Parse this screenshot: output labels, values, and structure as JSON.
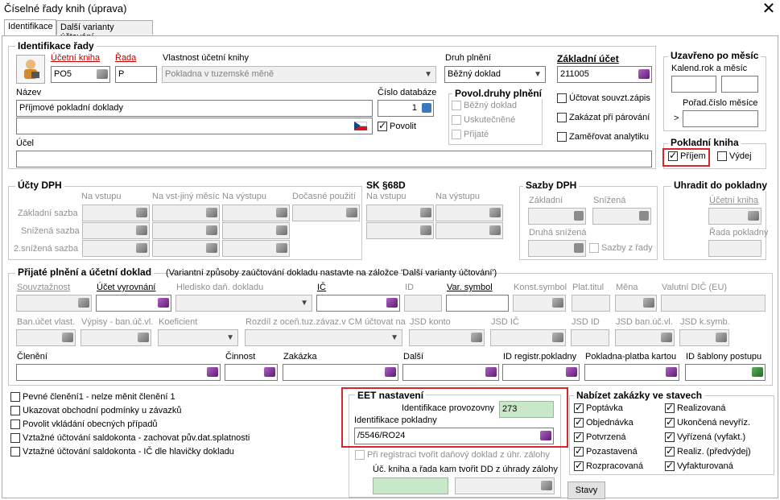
{
  "window": {
    "title": "Číselné řady knih (úprava)",
    "close": "✕"
  },
  "tabs": [
    "Identifikace",
    "Další varianty účtování"
  ],
  "ident": {
    "group_title": "Identifikace řady",
    "ucetni_kniha_label": "Účetní kniha",
    "ucetni_kniha_value": "PO5",
    "rada_label": "Řada",
    "rada_value": "P",
    "vlastnost_label": "Vlastnost účetní knihy",
    "vlastnost_value": "Pokladna v tuzemské měně",
    "nazev_label": "Název",
    "nazev_value": "Příjmové pokladní doklady",
    "cislo_db_label": "Číslo databáze",
    "cislo_db_value": "1",
    "povolit_label": "Povolit",
    "ucel_label": "Účel",
    "druh_plneni_label": "Druh plnění",
    "druh_plneni_value": "Běžný doklad",
    "zakladni_ucet_label": "Základní účet",
    "zakladni_ucet_value": "211005",
    "povol_title": "Povol.druhy plnění",
    "povol_items": [
      "Běžný doklad",
      "Uskutečněné",
      "Přijaté"
    ],
    "opts": [
      "Účtovat souvzt.zápis",
      "Zakázat při párování",
      "Zaměřovat analytiku"
    ]
  },
  "uzavreno": {
    "title": "Uzavřeno po měsíc",
    "kalend": "Kalend.rok a měsíc",
    "porad": "Pořad.číslo měsíce",
    "gt": ">"
  },
  "pokladni": {
    "title": "Pokladní kniha",
    "prijem": "Příjem",
    "vydej": "Výdej"
  },
  "ucty_dph": {
    "title": "Účty DPH",
    "cols": [
      "Na vstupu",
      "Na vst-jiný měsíc",
      "Na výstupu",
      "Dočasné použití"
    ],
    "rows": [
      "Základní sazba",
      "Snížená sazba",
      "2.snížená sazba"
    ]
  },
  "sk68": {
    "title": "SK §68D",
    "cols": [
      "Na vstupu",
      "Na výstupu"
    ]
  },
  "sazby": {
    "title": "Sazby DPH",
    "zakladni": "Základní",
    "snizena": "Snížená",
    "druha": "Druhá snížená",
    "sazby_z_rady": "Sazby z řady"
  },
  "uhradit": {
    "title": "Uhradit do pokladny",
    "ucetni_kniha": "Účetní kniha",
    "rada": "Řada pokladny"
  },
  "prijate": {
    "title": "Přijaté plnění a účetní doklad",
    "note": "(Variantní způsoby zaúčtování dokladu nastavte na záložce 'Další varianty účtování')",
    "row1": [
      "Souvztažnost",
      "Účet vyrovnání",
      "Hledisko daň. dokladu",
      "IČ",
      "ID",
      "Var. symbol",
      "Konst.symbol",
      "Plat.titul",
      "Měna",
      "Valutní DIČ (EU)"
    ],
    "row2": [
      "Ban.účet vlast.",
      "Výpisy - ban.úč.vl.",
      "Koeficient",
      "Rozdíl z oceň.tuz.závaz.v CM účtovat na",
      "JSD konto",
      "JSD IČ",
      "JSD ID",
      "JSD ban.úč.vl.",
      "JSD k.symb."
    ],
    "row3": [
      "Členění",
      "Činnost",
      "Zakázka",
      "Další",
      "ID registr.pokladny",
      "Pokladna-platba kartou",
      "ID šablony postupu"
    ]
  },
  "bottom_checks": [
    "Pevné členění1 - nelze měnit členění 1",
    "Ukazovat obchodní podmínky u závazků",
    "Povolit vkládání obecných případů",
    "Vztažné účtování saldokonta - zachovat pův.dat.splatnosti",
    "Vztažné účtování saldokonta - IČ dle hlavičky dokladu"
  ],
  "eet": {
    "title": "EET nastavení",
    "provozovna_label": "Identifikace provozovny",
    "provozovna_value": "273",
    "pokladna_label": "Identifikace pokladny",
    "pokladna_value": "/5546/RO24",
    "pri_registraci": "Při registraci tvořit daňový doklad z úhr. zálohy",
    "uc_kniha": "Úč. kniha a řada kam tvořit DD z úhrady zálohy"
  },
  "nabizet": {
    "title": "Nabízet zakázky ve stavech",
    "left": [
      "Poptávka",
      "Objednávka",
      "Potvrzená",
      "Pozastavená",
      "Rozpracovaná"
    ],
    "right": [
      "Realizovaná",
      "Ukončená nevyříz.",
      "Vyřízená (vyfakt.)",
      "Realiz. (předvýdej)",
      "Vyfakturovaná"
    ]
  },
  "stavy_button": "Stavy"
}
